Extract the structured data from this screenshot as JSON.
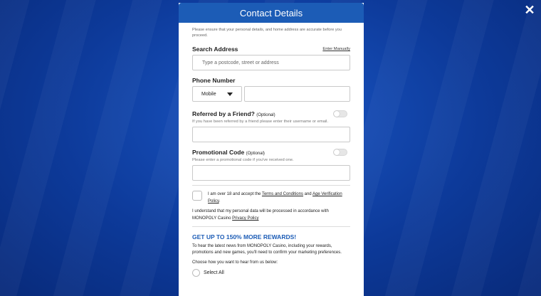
{
  "modal": {
    "title": "Contact Details",
    "intro": "Please ensure that your personal details, and home address are accurate before you proceed."
  },
  "address": {
    "label": "Search Address",
    "enter_manually": "Enter Manually",
    "placeholder": "Type a postcode, street or address"
  },
  "phone": {
    "label": "Phone Number",
    "type_selected": "Mobile",
    "number_value": ""
  },
  "referral": {
    "label": "Referred by a Friend?",
    "optional": "(Optional)",
    "hint": "If you have been referred by a friend please enter their username or email.",
    "value": ""
  },
  "promo": {
    "label": "Promotional Code",
    "optional": "(Optional)",
    "hint": "Please enter a promotional code if you've received one.",
    "value": ""
  },
  "terms": {
    "prefix": "I am over 18 and accept the ",
    "terms_link": "Terms and Conditions",
    "middle": " and ",
    "age_link": "Age Verification Policy",
    "suffix": "."
  },
  "privacy": {
    "prefix": "I understand that my personal data will be processed in accordance with MONOPOLY Casino ",
    "link": "Privacy Policy"
  },
  "rewards": {
    "title": "GET UP TO 150% MORE REWARDS!",
    "body": "To hear the latest news from MONOPOLY Casino, including your rewards, promotions and new games, you'll need to confirm your marketing preferences.",
    "choose": "Choose how you want to hear from us below:",
    "select_all": "Select All"
  },
  "close_icon": "close-icon",
  "colors": {
    "header_blue": "#1c5cb6",
    "background_blue": "#0d3a9a"
  }
}
